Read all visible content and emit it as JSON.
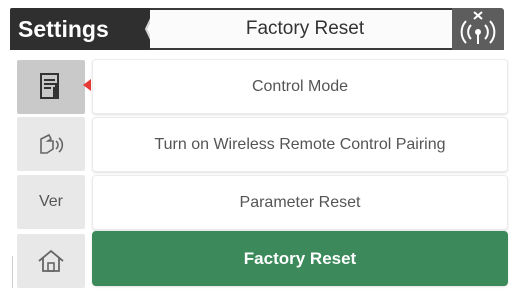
{
  "header": {
    "settings_label": "Settings",
    "title": "Factory Reset",
    "status_icon": "wireless-signal-off-icon"
  },
  "sidebar": {
    "items": [
      {
        "name": "manual-settings",
        "icon": "document-tools-icon",
        "label": ""
      },
      {
        "name": "remote-gesture",
        "icon": "hand-signal-icon",
        "label": ""
      },
      {
        "name": "version",
        "icon": "",
        "label": "Ver"
      },
      {
        "name": "home",
        "icon": "home-icon",
        "label": ""
      }
    ]
  },
  "menu": {
    "items": [
      {
        "label": "Control Mode",
        "selected": false
      },
      {
        "label": "Turn on Wireless Remote Control Pairing",
        "selected": false
      },
      {
        "label": "Parameter Reset",
        "selected": false
      },
      {
        "label": "Factory Reset",
        "selected": true
      }
    ]
  },
  "colors": {
    "header_dark": "#2f2f2f",
    "selected_green": "#3c8a5b",
    "marker_red": "#e53b37"
  }
}
